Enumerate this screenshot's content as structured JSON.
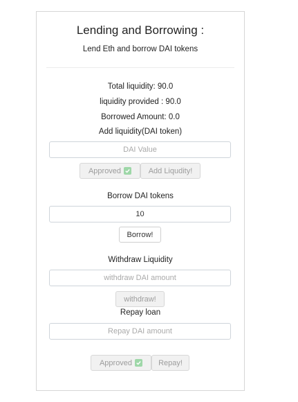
{
  "header": {
    "title": "Lending and Borrowing :",
    "subtitle": "Lend Eth and borrow DAI tokens"
  },
  "stats": {
    "total_liquidity": "Total liquidity: 90.0",
    "liquidity_provided": "liquidity provided : 90.0",
    "borrowed_amount": "Borrowed Amount: 0.0"
  },
  "add_liquidity": {
    "heading": "Add liquidity(DAI token)",
    "placeholder": "DAI Value",
    "approved_label": "Approved",
    "add_label": "Add Liqudity!"
  },
  "borrow": {
    "heading": "Borrow DAI tokens",
    "value": "10",
    "button_label": "Borrow!"
  },
  "withdraw": {
    "heading": "Withdraw Liquidity",
    "placeholder": "withdraw DAI amount",
    "button_label": "withdraw!"
  },
  "repay": {
    "heading": "Repay loan",
    "placeholder": "Repay DAI amount",
    "approved_label": "Approved",
    "button_label": "Repay!"
  },
  "icons": {
    "approved": "check-icon"
  },
  "colors": {
    "check_green": "#9ed7a8",
    "disabled_bg": "#f1f1f1",
    "border": "#d6d6d6"
  }
}
